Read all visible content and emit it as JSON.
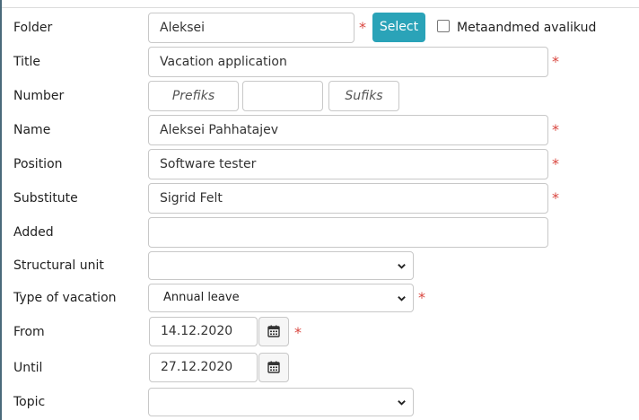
{
  "form": {
    "labels": {
      "folder": "Folder",
      "title": "Title",
      "number": "Number",
      "name": "Name",
      "position": "Position",
      "substitute": "Substitute",
      "added": "Added",
      "structural_unit": "Structural unit",
      "type_of_vacation": "Type of vacation",
      "from": "From",
      "until": "Until",
      "topic": "Topic"
    },
    "values": {
      "folder": "Aleksei",
      "title": "Vacation application",
      "number_main": "",
      "name": "Aleksei Pahhatajev",
      "position": "Software tester",
      "substitute": "Sigrid Felt",
      "added": "",
      "structural_unit": "",
      "type_of_vacation": "Annual leave",
      "from": "14.12.2020",
      "until": "27.12.2020",
      "topic": ""
    },
    "placeholders": {
      "number_prefix": "Prefiks",
      "number_suffix": "Sufiks"
    },
    "required_marker": "*",
    "select_button_label": "Select",
    "metadata_public_label": "Metaandmed avalikud",
    "metadata_public_checked": false
  },
  "colors": {
    "accent": "#2aa3b8",
    "required": "#d9463f",
    "border": "#c8c8c8"
  },
  "icons": {
    "calendar": "calendar-icon",
    "dropdown": "chevron-down-icon"
  }
}
